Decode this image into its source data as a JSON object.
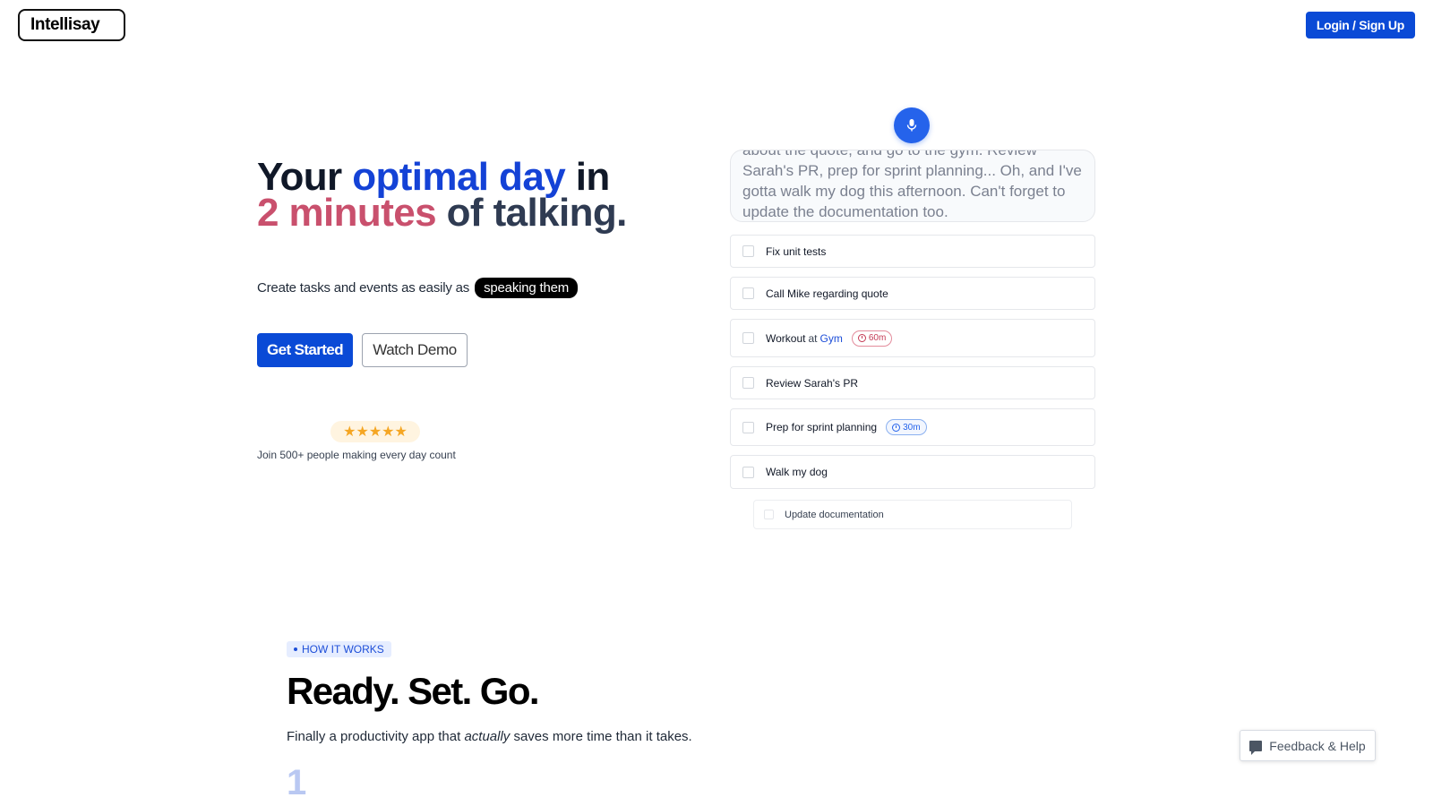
{
  "header": {
    "logo_text": "Intellisay",
    "login_label": "Login / Sign Up"
  },
  "hero": {
    "headline": {
      "part1": "Your ",
      "part2": "optimal day",
      "part3": " in",
      "part4": "2 minutes",
      "part5": " of talking."
    },
    "subline_prefix": "Create tasks and events as easily as",
    "subline_pill": "speaking them",
    "cta_primary": "Get Started",
    "cta_secondary": "Watch Demo",
    "rating_stars": "★★★★★",
    "rating_value": 5,
    "social_proof": "Join 500+ people making every day count"
  },
  "assistant": {
    "transcript": "about the quote, and go to the gym. Review Sarah's PR, prep for sprint planning... Oh, and I've gotta walk my dog this afternoon. Can't forget to update the documentation too.",
    "tasks": [
      {
        "title": "Fix unit tests"
      },
      {
        "title": "Call Mike regarding quote"
      },
      {
        "title": "Workout",
        "at": "at",
        "location": "Gym",
        "duration": "60m"
      },
      {
        "title": "Review Sarah's PR"
      },
      {
        "title": "Prep for sprint planning",
        "duration": "30m"
      },
      {
        "title": "Walk my dog"
      },
      {
        "title": "Update documentation"
      }
    ]
  },
  "how_it_works": {
    "tag": "HOW IT WORKS",
    "title": "Ready. Set. Go.",
    "subtitle_before": "Finally a productivity app that ",
    "subtitle_em": "actually",
    "subtitle_after": " saves more time than it takes.",
    "step_number": "1"
  },
  "feedback": {
    "label": "Feedback & Help"
  },
  "colors": {
    "primary_blue": "#0a4ad6",
    "headline_blue": "#1442d6",
    "headline_rose": "#c9506d",
    "mic_blue": "#2563eb",
    "star_gold": "#f5a623"
  },
  "icons": {
    "mic": "microphone-icon",
    "clock": "clock-icon",
    "chat": "chat-bubble-icon"
  }
}
